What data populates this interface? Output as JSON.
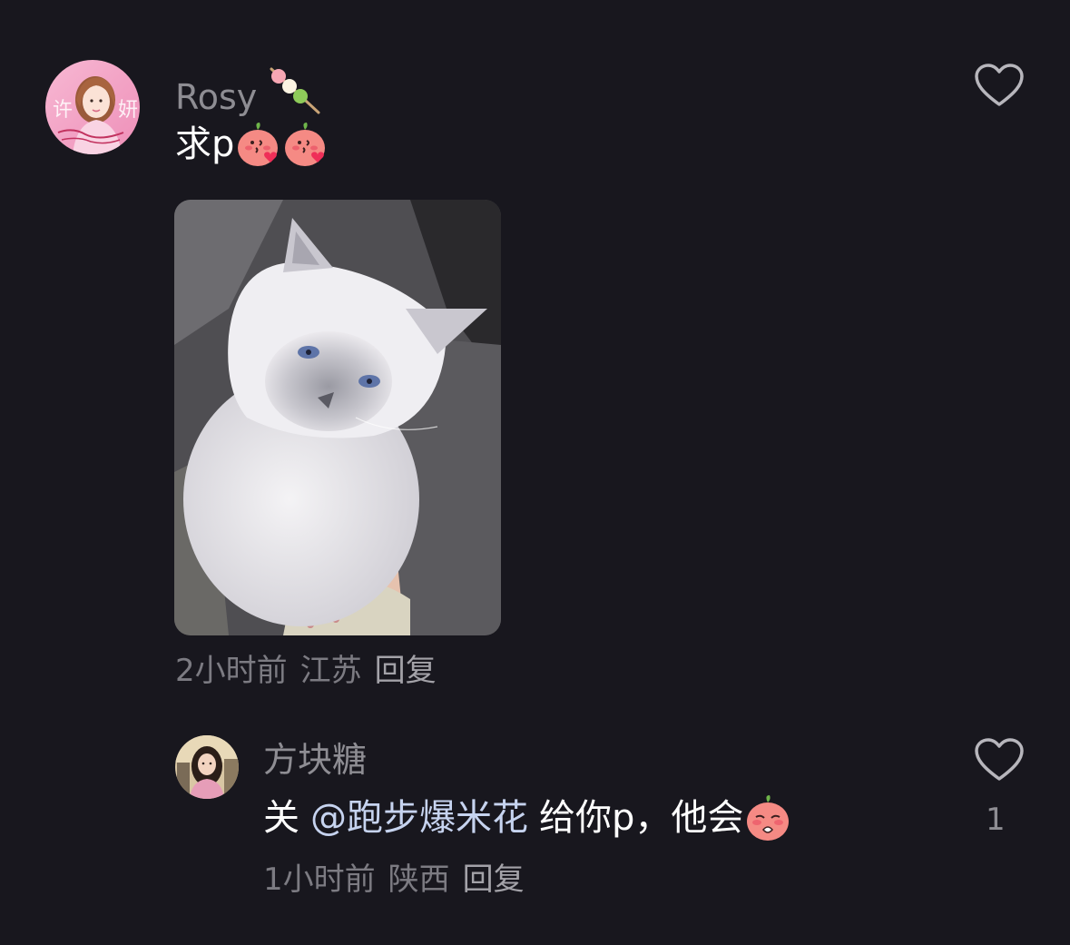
{
  "comment": {
    "username": "Rosy",
    "username_emoji": "dango-icon",
    "text_prefix": "求p",
    "text_emojis": [
      "kissing-face-emoji",
      "kissing-face-emoji"
    ],
    "avatar_text": "许妍",
    "image_alt": "cat-photo",
    "time": "2小时前",
    "location": "江苏",
    "reply_label": "回复",
    "like_icon": "heart-outline-icon"
  },
  "reply": {
    "username": "方块糖",
    "text_prefix": "关",
    "mention": "@跑步爆米花",
    "text_suffix": "给你p，他会",
    "text_emoji": "pleading-face-emoji",
    "time": "1小时前",
    "location": "陕西",
    "reply_label": "回复",
    "like_icon": "heart-outline-icon",
    "like_count": "1"
  },
  "colors": {
    "background": "#18171e",
    "username": "#8e8d93",
    "text": "#ffffff",
    "mention": "#c6d3ef",
    "meta": "#7c7b82"
  }
}
